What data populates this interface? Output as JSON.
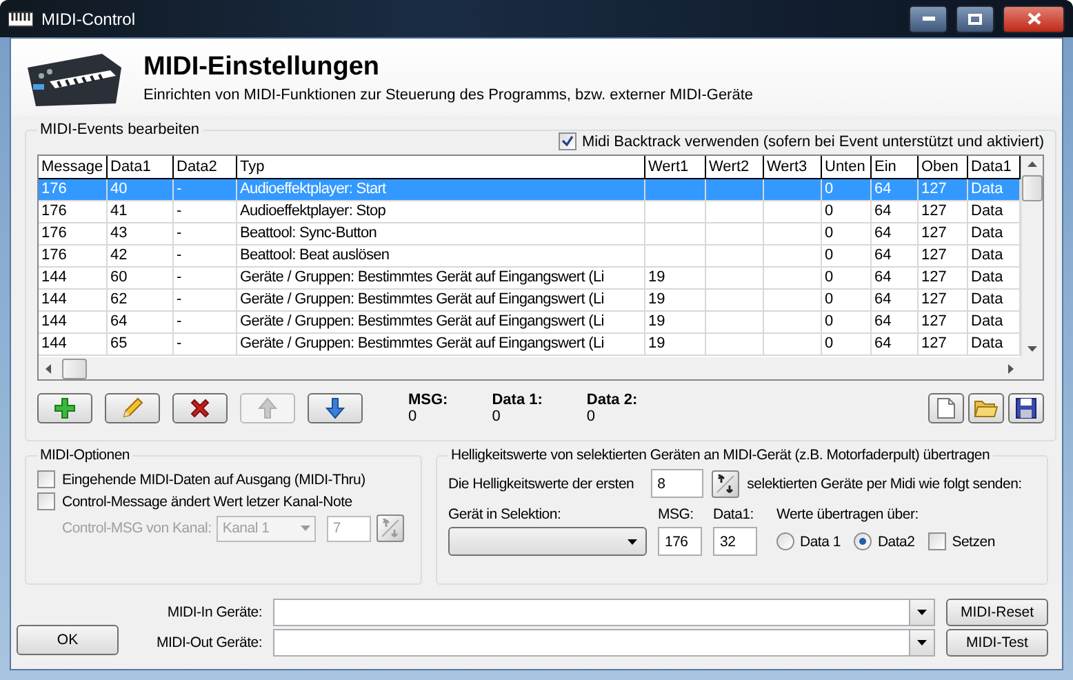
{
  "window": {
    "title": "MIDI-Control"
  },
  "header": {
    "title": "MIDI-Einstellungen",
    "subtitle": "Einrichten von MIDI-Funktionen zur Steuerung des Programms, bzw. externer MIDI-Geräte"
  },
  "events": {
    "title": "MIDI-Events bearbeiten",
    "backtrack": {
      "label": "Midi Backtrack verwenden (sofern bei Event unterstützt und aktiviert)",
      "checked": true
    },
    "columns": [
      "Message",
      "Data1",
      "Data2",
      "Typ",
      "Wert1",
      "Wert2",
      "Wert3",
      "Unten",
      "Ein",
      "Oben",
      "Data1"
    ],
    "rows": [
      {
        "selected": true,
        "cells": [
          "176",
          "40",
          "-",
          "Audioeffektplayer: Start",
          "",
          "",
          "",
          "0",
          "64",
          "127",
          "Data"
        ]
      },
      {
        "selected": false,
        "cells": [
          "176",
          "41",
          "-",
          "Audioeffektplayer: Stop",
          "",
          "",
          "",
          "0",
          "64",
          "127",
          "Data"
        ]
      },
      {
        "selected": false,
        "cells": [
          "176",
          "43",
          "-",
          "Beattool: Sync-Button",
          "",
          "",
          "",
          "0",
          "64",
          "127",
          "Data"
        ]
      },
      {
        "selected": false,
        "cells": [
          "176",
          "42",
          "-",
          "Beattool: Beat auslösen",
          "",
          "",
          "",
          "0",
          "64",
          "127",
          "Data"
        ]
      },
      {
        "selected": false,
        "cells": [
          "144",
          "60",
          "-",
          "Geräte / Gruppen: Bestimmtes Gerät auf Eingangswert (Li",
          "19",
          "",
          "",
          "0",
          "64",
          "127",
          "Data"
        ]
      },
      {
        "selected": false,
        "cells": [
          "144",
          "62",
          "-",
          "Geräte / Gruppen: Bestimmtes Gerät auf Eingangswert (Li",
          "19",
          "",
          "",
          "0",
          "64",
          "127",
          "Data"
        ]
      },
      {
        "selected": false,
        "cells": [
          "144",
          "64",
          "-",
          "Geräte / Gruppen: Bestimmtes Gerät auf Eingangswert (Li",
          "19",
          "",
          "",
          "0",
          "64",
          "127",
          "Data"
        ]
      },
      {
        "selected": false,
        "cells": [
          "144",
          "65",
          "-",
          "Geräte / Gruppen: Bestimmtes Gerät auf Eingangswert (Li",
          "19",
          "",
          "",
          "0",
          "64",
          "127",
          "Data"
        ]
      }
    ],
    "tools": [
      {
        "kind": "add",
        "disabled": false
      },
      {
        "kind": "edit",
        "disabled": false
      },
      {
        "kind": "delete",
        "disabled": false
      },
      {
        "kind": "up",
        "disabled": true
      },
      {
        "kind": "down",
        "disabled": false
      }
    ],
    "readouts": [
      {
        "label": "MSG:",
        "value": "0"
      },
      {
        "label": "Data 1:",
        "value": "0"
      },
      {
        "label": "Data 2:",
        "value": "0"
      }
    ],
    "file_tools": [
      {
        "kind": "new"
      },
      {
        "kind": "open"
      },
      {
        "kind": "save"
      }
    ]
  },
  "options": {
    "title": "MIDI-Optionen",
    "checkboxes": [
      {
        "label": "Eingehende MIDI-Daten auf Ausgang (MIDI-Thru)",
        "checked": false
      },
      {
        "label": "Control-Message ändert Wert letzer Kanal-Note",
        "checked": false
      }
    ],
    "channel": {
      "label": "Control-MSG von Kanal:",
      "combo": "Kanal 1",
      "spin": "7",
      "disabled": true
    }
  },
  "brightness": {
    "title": "Helligkeitswerte von selektierten Geräten an MIDI-Gerät (z.B. Motorfaderpult) übertragen",
    "prefix": "Die Helligkeitswerte der ersten",
    "count": "8",
    "suffix": "selektierten Geräte per Midi wie folgt senden:",
    "device_label": "Gerät in Selektion:",
    "msg_label": "MSG:",
    "msg": "176",
    "data1_label": "Data1:",
    "data1": "32",
    "transfer_label": "Werte übertragen über:",
    "radios": [
      {
        "label": "Data 1",
        "selected": false
      },
      {
        "label": "Data2",
        "selected": true
      }
    ],
    "set": {
      "label": "Setzen",
      "checked": false
    }
  },
  "ok": "OK",
  "devices": [
    {
      "label": "MIDI-In Geräte:",
      "button": "MIDI-Reset"
    },
    {
      "label": "MIDI-Out Geräte:",
      "button": "MIDI-Test"
    }
  ]
}
